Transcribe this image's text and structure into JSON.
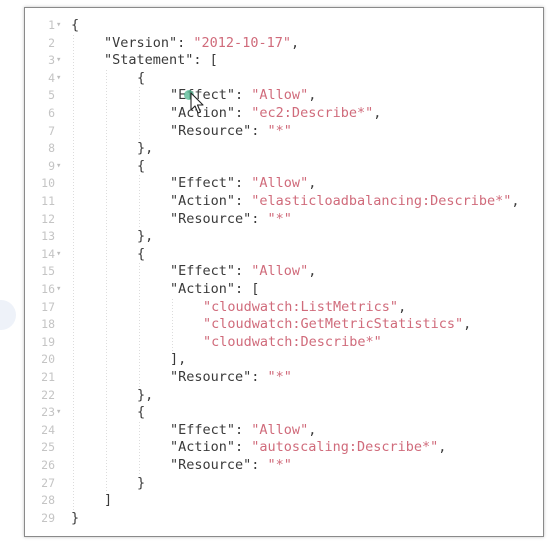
{
  "editor": {
    "lines": [
      {
        "n": "1",
        "fold": true,
        "indent": 0,
        "tokens": [
          {
            "t": "{",
            "c": "punc"
          }
        ]
      },
      {
        "n": "2",
        "fold": false,
        "indent": 1,
        "tokens": [
          {
            "t": "\"Version\"",
            "c": "key"
          },
          {
            "t": ": ",
            "c": "punc"
          },
          {
            "t": "\"2012-10-17\"",
            "c": "str"
          },
          {
            "t": ",",
            "c": "punc"
          }
        ]
      },
      {
        "n": "3",
        "fold": true,
        "indent": 1,
        "tokens": [
          {
            "t": "\"Statement\"",
            "c": "key"
          },
          {
            "t": ": [",
            "c": "punc"
          }
        ]
      },
      {
        "n": "4",
        "fold": true,
        "indent": 2,
        "tokens": [
          {
            "t": "{",
            "c": "punc"
          }
        ]
      },
      {
        "n": "5",
        "fold": false,
        "indent": 3,
        "tokens": [
          {
            "t": "\"Effect\"",
            "c": "key"
          },
          {
            "t": ": ",
            "c": "punc"
          },
          {
            "t": "\"Allow\"",
            "c": "str"
          },
          {
            "t": ",",
            "c": "punc"
          }
        ]
      },
      {
        "n": "6",
        "fold": false,
        "indent": 3,
        "tokens": [
          {
            "t": "\"Action\"",
            "c": "key"
          },
          {
            "t": ": ",
            "c": "punc"
          },
          {
            "t": "\"ec2:Describe*\"",
            "c": "str"
          },
          {
            "t": ",",
            "c": "punc"
          }
        ]
      },
      {
        "n": "7",
        "fold": false,
        "indent": 3,
        "tokens": [
          {
            "t": "\"Resource\"",
            "c": "key"
          },
          {
            "t": ": ",
            "c": "punc"
          },
          {
            "t": "\"*\"",
            "c": "str"
          }
        ]
      },
      {
        "n": "8",
        "fold": false,
        "indent": 2,
        "tokens": [
          {
            "t": "},",
            "c": "punc"
          }
        ]
      },
      {
        "n": "9",
        "fold": true,
        "indent": 2,
        "tokens": [
          {
            "t": "{",
            "c": "punc"
          }
        ]
      },
      {
        "n": "10",
        "fold": false,
        "indent": 3,
        "tokens": [
          {
            "t": "\"Effect\"",
            "c": "key"
          },
          {
            "t": ": ",
            "c": "punc"
          },
          {
            "t": "\"Allow\"",
            "c": "str"
          },
          {
            "t": ",",
            "c": "punc"
          }
        ]
      },
      {
        "n": "11",
        "fold": false,
        "indent": 3,
        "tokens": [
          {
            "t": "\"Action\"",
            "c": "key"
          },
          {
            "t": ": ",
            "c": "punc"
          },
          {
            "t": "\"elasticloadbalancing:Describe*\"",
            "c": "str"
          },
          {
            "t": ",",
            "c": "punc"
          }
        ]
      },
      {
        "n": "12",
        "fold": false,
        "indent": 3,
        "tokens": [
          {
            "t": "\"Resource\"",
            "c": "key"
          },
          {
            "t": ": ",
            "c": "punc"
          },
          {
            "t": "\"*\"",
            "c": "str"
          }
        ]
      },
      {
        "n": "13",
        "fold": false,
        "indent": 2,
        "tokens": [
          {
            "t": "},",
            "c": "punc"
          }
        ]
      },
      {
        "n": "14",
        "fold": true,
        "indent": 2,
        "tokens": [
          {
            "t": "{",
            "c": "punc"
          }
        ]
      },
      {
        "n": "15",
        "fold": false,
        "indent": 3,
        "tokens": [
          {
            "t": "\"Effect\"",
            "c": "key"
          },
          {
            "t": ": ",
            "c": "punc"
          },
          {
            "t": "\"Allow\"",
            "c": "str"
          },
          {
            "t": ",",
            "c": "punc"
          }
        ]
      },
      {
        "n": "16",
        "fold": true,
        "indent": 3,
        "tokens": [
          {
            "t": "\"Action\"",
            "c": "key"
          },
          {
            "t": ": [",
            "c": "punc"
          }
        ]
      },
      {
        "n": "17",
        "fold": false,
        "indent": 4,
        "tokens": [
          {
            "t": "\"cloudwatch:ListMetrics\"",
            "c": "str"
          },
          {
            "t": ",",
            "c": "punc"
          }
        ]
      },
      {
        "n": "18",
        "fold": false,
        "indent": 4,
        "tokens": [
          {
            "t": "\"cloudwatch:GetMetricStatistics\"",
            "c": "str"
          },
          {
            "t": ",",
            "c": "punc"
          }
        ]
      },
      {
        "n": "19",
        "fold": false,
        "indent": 4,
        "tokens": [
          {
            "t": "\"cloudwatch:Describe*\"",
            "c": "str"
          }
        ]
      },
      {
        "n": "20",
        "fold": false,
        "indent": 3,
        "tokens": [
          {
            "t": "],",
            "c": "punc"
          }
        ]
      },
      {
        "n": "21",
        "fold": false,
        "indent": 3,
        "tokens": [
          {
            "t": "\"Resource\"",
            "c": "key"
          },
          {
            "t": ": ",
            "c": "punc"
          },
          {
            "t": "\"*\"",
            "c": "str"
          }
        ]
      },
      {
        "n": "22",
        "fold": false,
        "indent": 2,
        "tokens": [
          {
            "t": "},",
            "c": "punc"
          }
        ]
      },
      {
        "n": "23",
        "fold": true,
        "indent": 2,
        "tokens": [
          {
            "t": "{",
            "c": "punc"
          }
        ]
      },
      {
        "n": "24",
        "fold": false,
        "indent": 3,
        "tokens": [
          {
            "t": "\"Effect\"",
            "c": "key"
          },
          {
            "t": ": ",
            "c": "punc"
          },
          {
            "t": "\"Allow\"",
            "c": "str"
          },
          {
            "t": ",",
            "c": "punc"
          }
        ]
      },
      {
        "n": "25",
        "fold": false,
        "indent": 3,
        "tokens": [
          {
            "t": "\"Action\"",
            "c": "key"
          },
          {
            "t": ": ",
            "c": "punc"
          },
          {
            "t": "\"autoscaling:Describe*\"",
            "c": "str"
          },
          {
            "t": ",",
            "c": "punc"
          }
        ]
      },
      {
        "n": "26",
        "fold": false,
        "indent": 3,
        "tokens": [
          {
            "t": "\"Resource\"",
            "c": "key"
          },
          {
            "t": ": ",
            "c": "punc"
          },
          {
            "t": "\"*\"",
            "c": "str"
          }
        ]
      },
      {
        "n": "27",
        "fold": false,
        "indent": 2,
        "tokens": [
          {
            "t": "}",
            "c": "punc"
          }
        ]
      },
      {
        "n": "28",
        "fold": false,
        "indent": 1,
        "tokens": [
          {
            "t": "]",
            "c": "punc"
          }
        ]
      },
      {
        "n": "29",
        "fold": false,
        "indent": 0,
        "tokens": [
          {
            "t": "}",
            "c": "punc"
          }
        ]
      }
    ]
  },
  "icons": {
    "fold": "fold-arrow-icon",
    "cursor": "mouse-pointer-icon"
  },
  "colors": {
    "string": "#d06b7b",
    "text": "#3a3a3a",
    "line_number": "#c4c4c4"
  }
}
